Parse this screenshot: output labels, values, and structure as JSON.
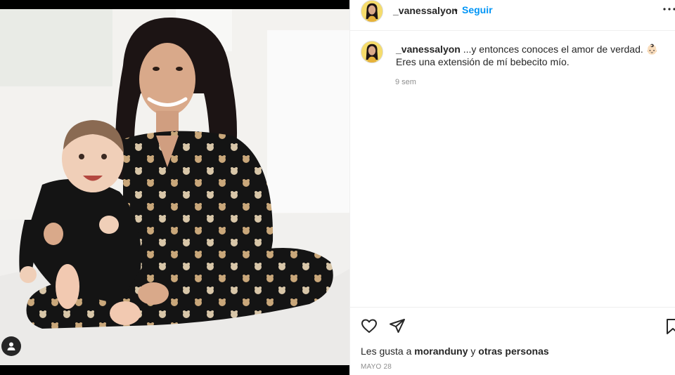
{
  "post": {
    "username": "_vanessalyon",
    "dot": "•",
    "follow_label": "Seguir"
  },
  "caption": {
    "username": "_vanessalyon",
    "text": " ...y entonces conoces el amor de verdad. 👶🏻 Eres una extensión de mí bebecito mío.",
    "time": "9 sem"
  },
  "likes": {
    "prefix": "Les gusta a ",
    "user": "moranduny",
    "connector": " y ",
    "others": "otras personas"
  },
  "date": "MAYO 28",
  "icons": {
    "more": "more-options-icon",
    "like": "heart-icon",
    "share": "paper-plane-icon",
    "save": "bookmark-icon",
    "tags": "user-tag-icon"
  },
  "colors": {
    "link": "#0095f6",
    "text": "#262626",
    "muted": "#8e8e8e",
    "border": "#efefef"
  }
}
